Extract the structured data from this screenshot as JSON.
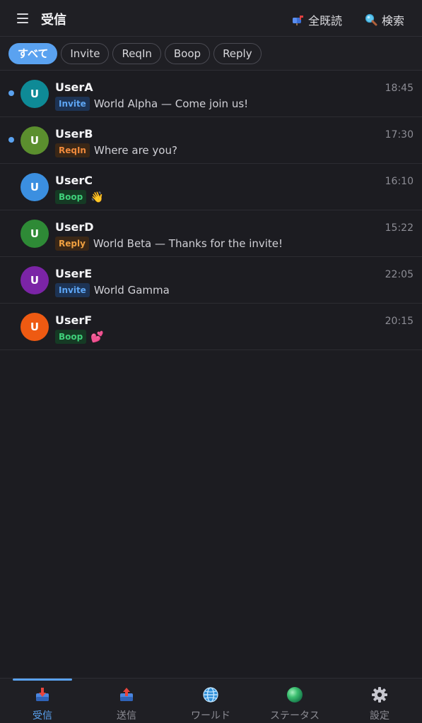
{
  "header": {
    "title": "受信",
    "mark_all_read_label": "全既読",
    "search_label": "検索"
  },
  "filters": [
    {
      "label": "すべて",
      "active": true
    },
    {
      "label": "Invite",
      "active": false
    },
    {
      "label": "ReqIn",
      "active": false
    },
    {
      "label": "Boop",
      "active": false
    },
    {
      "label": "Reply",
      "active": false
    }
  ],
  "messages": [
    {
      "avatar": "U",
      "avatar_color": "#0e8a96",
      "name": "UserA",
      "time": "18:45",
      "tag": "Invite",
      "text": "World Alpha — Come join us!",
      "unread": true
    },
    {
      "avatar": "U",
      "avatar_color": "#5b8f2e",
      "name": "UserB",
      "time": "17:30",
      "tag": "ReqIn",
      "text": "Where are you?",
      "unread": true
    },
    {
      "avatar": "U",
      "avatar_color": "#3b8fe0",
      "name": "UserC",
      "time": "16:10",
      "tag": "Boop",
      "text": "👋",
      "unread": false
    },
    {
      "avatar": "U",
      "avatar_color": "#2e8a36",
      "name": "UserD",
      "time": "15:22",
      "tag": "Reply",
      "text": "World Beta — Thanks for the invite!",
      "unread": false
    },
    {
      "avatar": "U",
      "avatar_color": "#7b24a6",
      "name": "UserE",
      "time": "22:05",
      "tag": "Invite",
      "text": "World Gamma",
      "unread": false
    },
    {
      "avatar": "U",
      "avatar_color": "#ee5a12",
      "name": "UserF",
      "time": "20:15",
      "tag": "Boop",
      "text": "💕",
      "unread": false
    }
  ],
  "bottom_nav": [
    {
      "label": "受信",
      "icon": "inbox-tray-icon",
      "active": true
    },
    {
      "label": "送信",
      "icon": "outbox-tray-icon",
      "active": false
    },
    {
      "label": "ワールド",
      "icon": "globe-icon",
      "active": false
    },
    {
      "label": "ステータス",
      "icon": "status-orb-icon",
      "active": false
    },
    {
      "label": "設定",
      "icon": "gear-icon",
      "active": false
    }
  ],
  "colors": {
    "accent": "#5aa2f0",
    "background": "#1c1c21"
  }
}
